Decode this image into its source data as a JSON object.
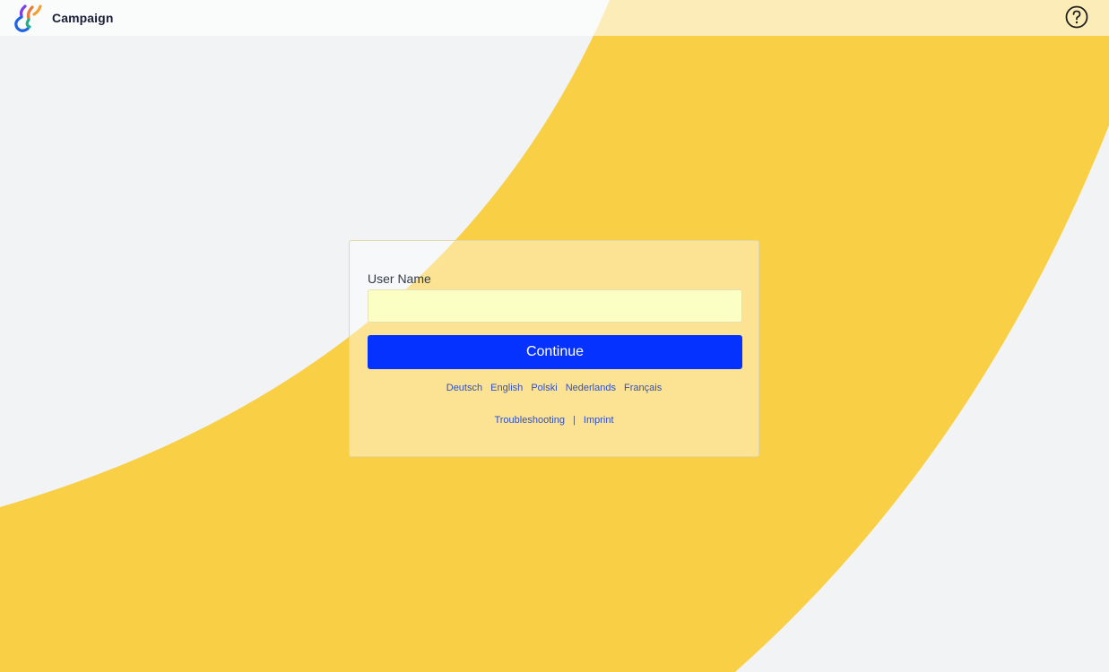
{
  "header": {
    "app_name": "Campaign",
    "logo_icon": "campaign-logo-icon",
    "help_icon": "help-circle-icon"
  },
  "login": {
    "username_label": "User Name",
    "username_value": "",
    "username_placeholder": "",
    "continue_label": "Continue",
    "languages": [
      "Deutsch",
      "English",
      "Polski",
      "Nederlands",
      "Français"
    ],
    "footer_links": {
      "troubleshooting": "Troubleshooting",
      "separator": "|",
      "imprint": "Imprint"
    }
  },
  "colors": {
    "background": "#f2f3f5",
    "accent_band": "#f8cf45",
    "primary_button": "#0532ff",
    "input_autofill": "#fbffc4",
    "link": "#2f4fc9"
  }
}
